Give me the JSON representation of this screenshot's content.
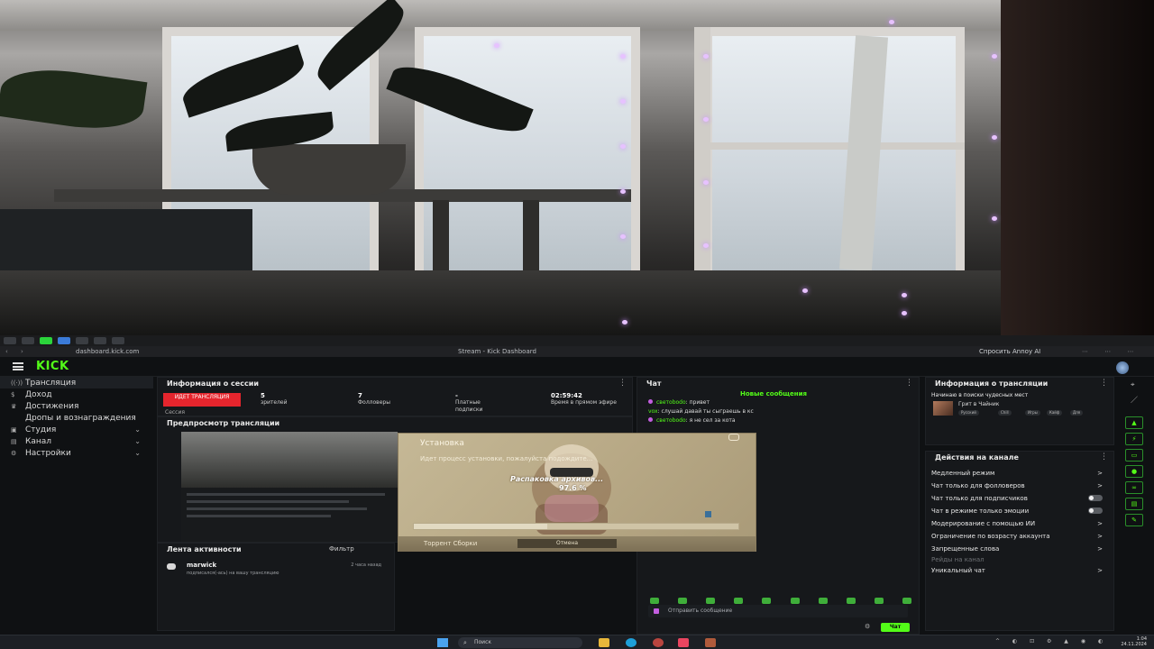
{
  "browser": {
    "url": "dashboard.kick.com",
    "page_title": "Stream - Kick Dashboard",
    "copilot": "Спросить Annoy AI"
  },
  "brand": {
    "logo": "KICK",
    "accent": "#53fc18"
  },
  "sidebar": {
    "items": [
      {
        "label": "Трансляция",
        "icon": "broadcast-icon",
        "active": true
      },
      {
        "label": "Доход",
        "icon": "money-icon"
      },
      {
        "label": "Достижения",
        "icon": "trophy-icon"
      },
      {
        "label": "Дропы и вознаграждения",
        "icon": "gift-icon"
      },
      {
        "label": "Студия",
        "icon": "studio-icon"
      },
      {
        "label": "Канал",
        "icon": "channel-icon"
      },
      {
        "label": "Настройки",
        "icon": "gear-icon"
      }
    ]
  },
  "session": {
    "title": "Информация о сессии",
    "live_label": "ИДЕТ ТРАНСЛЯЦИЯ",
    "session_label": "Сессия",
    "stats": [
      {
        "value": "5",
        "label": "зрителей"
      },
      {
        "value": "7",
        "label": "Фолловеры"
      },
      {
        "value": "-",
        "label": "Платные подписки"
      },
      {
        "value": "02:59:42",
        "label": "Время в прямом эфире"
      }
    ]
  },
  "preview": {
    "title": "Предпросмотр трансляции"
  },
  "installer": {
    "title": "Установка",
    "text": "Идет процесс установки, пожалуйста подождите...",
    "status": "Распаковка архивов...",
    "progress_percent": 97.6,
    "progress_label": "97.6 %",
    "link": "Торрент Сборки",
    "button": "Отмена"
  },
  "activity": {
    "title": "Лента активности",
    "filter_label": "Фильтр",
    "items": [
      {
        "name": "marwick",
        "desc": "подписался(-ась) на вашу трансляцию",
        "time": "2 часа назад"
      }
    ]
  },
  "chat": {
    "title": "Чат",
    "new_messages": "Новые сообщения",
    "messages": [
      {
        "user": "светоbodo",
        "text": "привет"
      },
      {
        "user": "vox",
        "text": "слушай давай ты сыграешь в кс"
      },
      {
        "user": "светоbodo",
        "text": "я не сел за кота"
      }
    ],
    "input_placeholder": "Отправить сообщение",
    "send_label": "Чат"
  },
  "stream_info": {
    "title": "Информация о трансляции",
    "stream_title": "Начинаю в поиски чудесных мест",
    "category": "Грит в Чайник",
    "tags": [
      "Русский",
      "Chill",
      "Игры",
      "Кайф",
      "Для"
    ]
  },
  "actions": {
    "title": "Действия на канале",
    "items": [
      {
        "label": "Медленный режим",
        "control": "arrow"
      },
      {
        "label": "Чат только для фолловеров",
        "control": "arrow"
      },
      {
        "label": "Чат только для подписчиков",
        "control": "toggle"
      },
      {
        "label": "Чат в режиме только эмоции",
        "control": "toggle"
      },
      {
        "label": "Модерирование с помощью ИИ",
        "control": "arrow"
      },
      {
        "label": "Ограничение по возрасту аккаунта",
        "control": "arrow"
      },
      {
        "label": "Запрещенные слова",
        "control": "arrow"
      },
      {
        "label": "Рейды на канал",
        "control": "none",
        "muted": true
      },
      {
        "label": "Уникальный чат",
        "control": "arrow"
      }
    ]
  },
  "taskbar": {
    "search": "Поиск",
    "time": "1:04",
    "date": "24.11.2024"
  }
}
